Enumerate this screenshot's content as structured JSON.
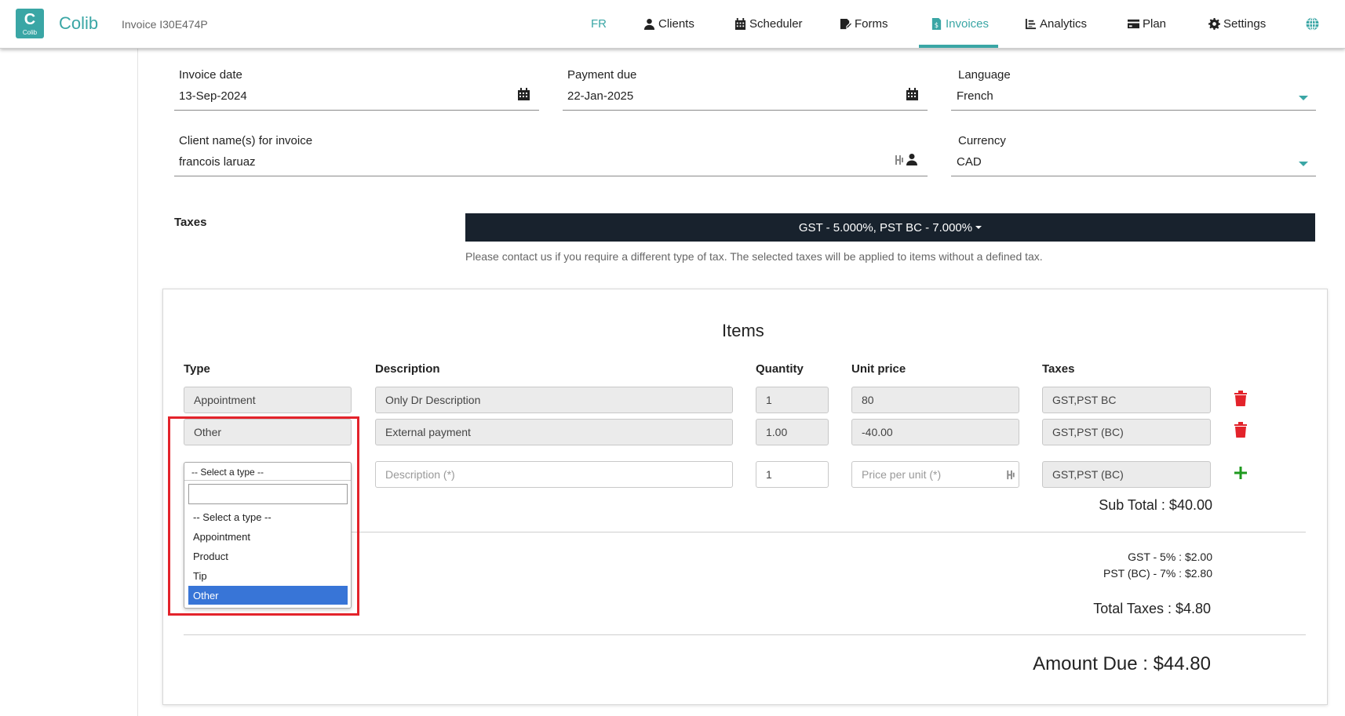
{
  "app": {
    "logo_letter": "C",
    "logo_text": "Colib",
    "brand": "Colib",
    "invoice_id": "Invoice I30E474P"
  },
  "nav": {
    "lang": "FR",
    "items": [
      {
        "label": "Clients",
        "icon": "user-icon"
      },
      {
        "label": "Scheduler",
        "icon": "calendar-grid-icon"
      },
      {
        "label": "Forms",
        "icon": "form-edit-icon"
      },
      {
        "label": "Invoices",
        "icon": "invoice-icon",
        "active": true
      },
      {
        "label": "Analytics",
        "icon": "chart-icon"
      },
      {
        "label": "Plan",
        "icon": "credit-card-icon"
      },
      {
        "label": "Settings",
        "icon": "gear-icon"
      }
    ],
    "globe_icon": "globe-icon",
    "accent": "#3aa6a5"
  },
  "form": {
    "invoice_date": {
      "label": "Invoice date",
      "value": "13-Sep-2024"
    },
    "payment_due": {
      "label": "Payment due",
      "value": "22-Jan-2025"
    },
    "language": {
      "label": "Language",
      "value": "French"
    },
    "client": {
      "label": "Client name(s) for invoice",
      "value": "francois laruaz"
    },
    "currency": {
      "label": "Currency",
      "value": "CAD"
    }
  },
  "taxes": {
    "label": "Taxes",
    "selected": "GST - 5.000%, PST BC - 7.000%",
    "note": "Please contact us if you require a different type of tax. The selected taxes will be applied to items without a defined tax."
  },
  "items": {
    "title": "Items",
    "headers": {
      "type": "Type",
      "description": "Description",
      "quantity": "Quantity",
      "unit_price": "Unit price",
      "taxes": "Taxes"
    },
    "rows": [
      {
        "type": "Appointment",
        "description": "Only Dr Description",
        "quantity": "1",
        "unit_price": "80",
        "taxes": "GST,PST BC"
      },
      {
        "type": "Other",
        "description": "External payment",
        "quantity": "1.00",
        "unit_price": "-40.00",
        "taxes": "GST,PST (BC)"
      }
    ],
    "new_row": {
      "description_placeholder": "Description (*)",
      "quantity": "1",
      "price_placeholder": "Price per unit (*)",
      "taxes": "GST,PST (BC)"
    },
    "type_dropdown": {
      "selected": "-- Select a type --",
      "options": [
        "-- Select a type --",
        "Appointment",
        "Product",
        "Tip",
        "Other"
      ],
      "highlighted": "Other"
    }
  },
  "totals": {
    "sub_total": "Sub Total : $40.00",
    "gst": "GST - 5% : $2.00",
    "pst": "PST (BC) - 7% : $2.80",
    "total_taxes": "Total Taxes : $4.80",
    "amount_due": "Amount Due : $44.80"
  }
}
